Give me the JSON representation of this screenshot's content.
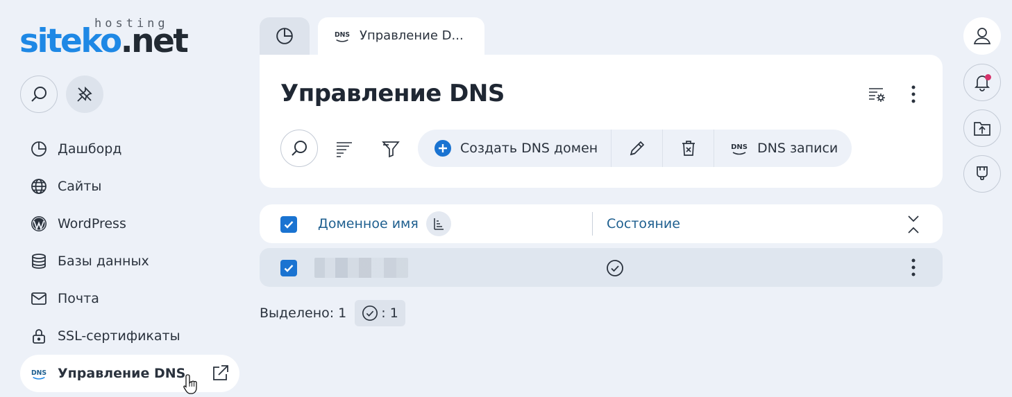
{
  "logo": {
    "hosting": "hosting",
    "brand_a": "siteko",
    "brand_b": ".net"
  },
  "colors": {
    "accent": "#1a73d1",
    "brand": "#1e88e5",
    "background": "#edf1f8",
    "notification": "#d6336c"
  },
  "sidebar": {
    "items": [
      {
        "label": "Дашборд",
        "icon": "chart-pie-icon"
      },
      {
        "label": "Сайты",
        "icon": "globe-icon"
      },
      {
        "label": "WordPress",
        "icon": "wordpress-icon"
      },
      {
        "label": "Базы данных",
        "icon": "database-icon"
      },
      {
        "label": "Почта",
        "icon": "mail-icon"
      },
      {
        "label": "SSL-сертификаты",
        "icon": "lock-icon"
      },
      {
        "label": "Управление DNS",
        "icon": "dns-icon",
        "active": true
      }
    ]
  },
  "tabs": [
    {
      "icon": "chart-pie-icon"
    },
    {
      "icon": "dns-icon",
      "label": "Управление D..."
    }
  ],
  "page": {
    "title": "Управление DNS"
  },
  "toolbar": {
    "create_label": "Создать DNS домен",
    "dns_records_label": "DNS записи",
    "dns_badge": "DNS"
  },
  "table": {
    "columns": [
      {
        "label": "Доменное имя"
      },
      {
        "label": "Состояние"
      }
    ],
    "rows": [
      {
        "domain": "",
        "status": "active",
        "selected": true
      }
    ]
  },
  "summary": {
    "selected_label": "Выделено: 1",
    "status_count": ": 1"
  }
}
